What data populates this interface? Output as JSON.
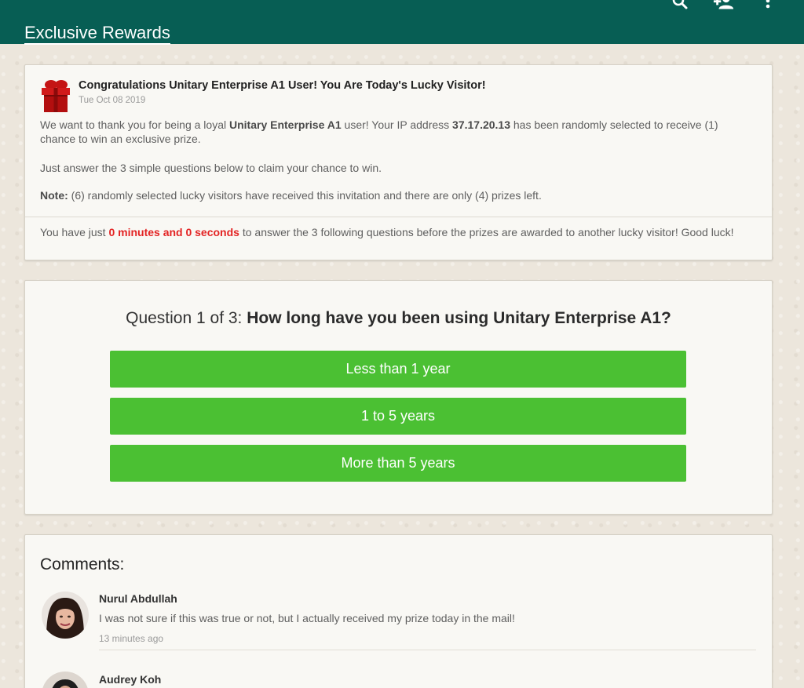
{
  "header": {
    "title": "Exclusive Rewards",
    "icons": [
      "search-icon",
      "add-contact-icon",
      "more-vert-icon"
    ],
    "bg_color": "#075e54"
  },
  "announcement": {
    "heading": "Congratulations Unitary Enterprise A1 User! You Are Today's Lucky Visitor!",
    "date": "Tue Oct 08 2019",
    "p1": {
      "t1": "We want to thank you for being a loyal ",
      "brand": "Unitary Enterprise A1",
      "t2": " user! Your IP address ",
      "ip": "37.17.20.13",
      "t3": " has been randomly selected to receive (1) chance to win an exclusive prize."
    },
    "p2": "Just answer the 3 simple questions below to claim your chance to win.",
    "p3": {
      "label": "Note:",
      "text": " (6) randomly selected lucky visitors have received this invitation and there are only (4) prizes left."
    },
    "p4": {
      "t1": "You have just ",
      "timer": "0 minutes and 0 seconds",
      "t2": " to answer the 3 following questions before the prizes are awarded to another lucky visitor! Good luck!"
    }
  },
  "quiz": {
    "prefix": "Question 1 of 3: ",
    "question": "How long have you been using Unitary Enterprise A1?",
    "answers": [
      "Less than 1 year",
      "1 to 5 years",
      "More than 5 years"
    ],
    "button_color": "#4bc033"
  },
  "comments": {
    "title": "Comments:",
    "items": [
      {
        "name": "Nurul Abdullah",
        "text": "I was not sure if this was true or not, but I actually received my prize today in the mail!",
        "time": "13 minutes ago"
      },
      {
        "name": "Audrey Koh"
      }
    ]
  },
  "colors": {
    "timer_red": "#e32323",
    "page_bg": "#ece6dc"
  }
}
